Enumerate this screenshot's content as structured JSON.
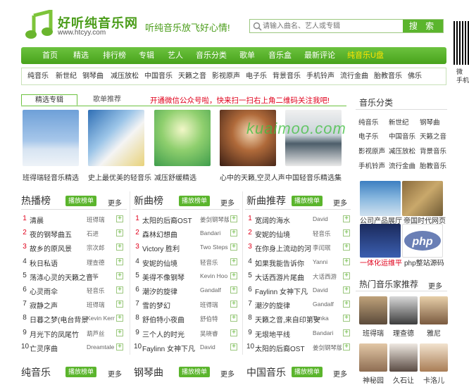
{
  "header": {
    "site_name": "好听纯音乐网",
    "site_url": "www.htcyy.com",
    "slogan": "听纯音乐放飞好心情!",
    "search_placeholder": "请输入曲名、艺人或专辑",
    "search_button": "搜 索",
    "qr_caption": "微 手机"
  },
  "nav": [
    "首页",
    "精选",
    "排行榜",
    "专辑",
    "艺人",
    "音乐分类",
    "歌单",
    "音乐盒",
    "最新评论",
    "纯音乐U盘"
  ],
  "nav_highlight": "#ffe400",
  "subnav": [
    "纯音乐",
    "新世纪",
    "钢琴曲",
    "减压放松",
    "中国音乐",
    "天籁之音",
    "影视原声",
    "电子乐",
    "背景音乐",
    "手机铃声",
    "流行金曲",
    "胎教音乐",
    "佛乐"
  ],
  "tabs": {
    "featured": "精选专辑",
    "recommend": "歌单推荐"
  },
  "notice": "开通微信公众号啦，快来扫一扫右上角二维码关注我吧!",
  "albums": [
    "班得瑞轻音乐精选",
    "史上最优美的轻音乐",
    "减压舒缓精选",
    "心中的天籁,空灵人声",
    "中国轻音乐精选集"
  ],
  "watermark": "kuaimoo.com",
  "categories": {
    "title": "音乐分类",
    "items": [
      "纯音乐",
      "新世纪",
      "钢琴曲",
      "电子乐",
      "中国音乐",
      "天籁之音",
      "影视原声",
      "减压放松",
      "背景音乐",
      "手机铃声",
      "流行金曲",
      "胎教音乐"
    ]
  },
  "ads": [
    "公司产品展厅",
    "帝国时代网页",
    "一体化运维平",
    "php整站源码"
  ],
  "artists": {
    "title": "热门音乐家推荐",
    "more": "更多",
    "names": [
      "班得瑞",
      "理查德",
      "雅尼",
      "神秘园",
      "久石让",
      "卡洛儿"
    ]
  },
  "lists": {
    "play_label": "播放榜单",
    "more_label": "更多",
    "hot": {
      "title": "热播榜",
      "rows": [
        [
          "清晨",
          "班得瑞"
        ],
        [
          "夜的钢琴曲五",
          "石进"
        ],
        [
          "故乡的原风景",
          "宗次郎"
        ],
        [
          "秋日私语",
          "理查德"
        ],
        [
          "荡涤心灵的天籁之音",
          "古筝"
        ],
        [
          "心灵雨伞",
          "轻音乐"
        ],
        [
          "寂静之声",
          "班得瑞"
        ],
        [
          "日暮之梦(电台背景",
          "Kevin Kern"
        ],
        [
          "月光下的凤尾竹",
          "葫芦丝"
        ],
        [
          "亡灵序曲",
          "Dreamtale"
        ]
      ]
    },
    "newsong": {
      "title": "新曲榜",
      "rows": [
        [
          "太阳的后裔OST",
          "姜剑钢琴版"
        ],
        [
          "森林幻想曲",
          "Bandari"
        ],
        [
          "Victory 胜利",
          "Two Steps"
        ],
        [
          "安妮的仙境",
          "轻音乐"
        ],
        [
          "美得不像钢琴",
          "Kevin Hoo"
        ],
        [
          "潮汐的旋律",
          "Gandalf"
        ],
        [
          "雪的梦幻",
          "班得瑞"
        ],
        [
          "舒伯特小夜曲",
          "舒伯特"
        ],
        [
          "三个人的时光",
          "吴晓睿"
        ],
        [
          "Faylinn 女神下凡",
          "David"
        ]
      ]
    },
    "recommend": {
      "title": "新曲推荐",
      "rows": [
        [
          "宽阔的海水",
          "David"
        ],
        [
          "安妮的仙境",
          "轻音乐"
        ],
        [
          "在你身上流动的河",
          "李闰珉"
        ],
        [
          "如果我能告诉你",
          "Yanni"
        ],
        [
          "大话西游片尾曲",
          "大话西游"
        ],
        [
          "Faylinn 女神下凡",
          "David"
        ],
        [
          "潮汐的旋律",
          "Gandalf"
        ],
        [
          "天籁之音,来自印第安",
          "Tanka"
        ],
        [
          "无垠地平线",
          "Bandari"
        ],
        [
          "太阳的后裔OST",
          "姜剑钢琴版"
        ]
      ]
    }
  },
  "bottom_sections": [
    "纯音乐",
    "钢琴曲",
    "中国音乐"
  ],
  "colors": {
    "brand": "#4a9c19",
    "accent": "#5bb52d",
    "rank": "#e0001b"
  }
}
